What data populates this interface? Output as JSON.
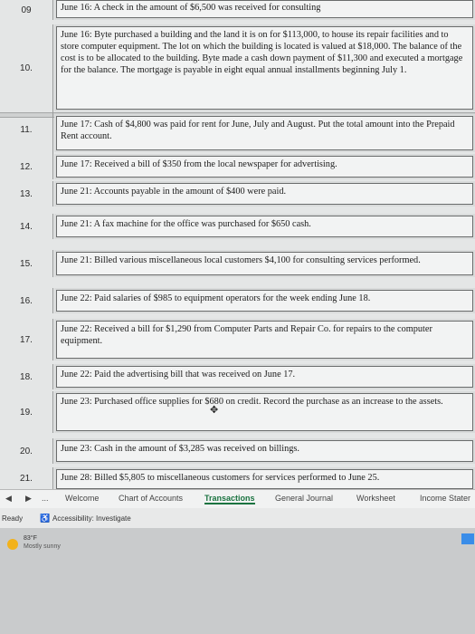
{
  "header": {
    "row_num": "09",
    "text": "June 16: A check in the amount of $6,500 was received for consulting"
  },
  "rows": [
    {
      "num": "10.",
      "text": "June 16: Byte purchased a building and the land it is on for $113,000, to house its repair facilities and to store computer equipment. The lot on which the building is located is valued at $18,000. The balance of the cost is to be allocated to the building. Byte made a cash down payment of $11,300 and executed a mortgage for the balance. The mortgage is payable in eight equal annual installments beginning July 1."
    },
    {
      "num": "11.",
      "text": "June 17: Cash of $4,800 was paid for rent for June, July and August. Put the total amount into the Prepaid Rent account."
    },
    {
      "num": "12.",
      "text": "June 17: Received a bill of $350 from the local newspaper for advertising."
    },
    {
      "num": "13.",
      "text": "June 21: Accounts payable in the amount of $400 were paid."
    },
    {
      "num": "14.",
      "text": "June 21: A fax machine for the office was purchased for $650 cash."
    },
    {
      "num": "15.",
      "text": "June 21: Billed various miscellaneous local customers $4,100 for consulting services performed."
    },
    {
      "num": "16.",
      "text": "June 22: Paid salaries of $985 to equipment operators for the week ending June 18."
    },
    {
      "num": "17.",
      "text": "June 22: Received a bill for $1,290 from Computer Parts and Repair Co. for repairs to the computer equipment."
    },
    {
      "num": "18.",
      "text": "June 22: Paid the advertising bill that was received on June 17."
    },
    {
      "num": "19.",
      "text": "June 23: Purchased office supplies for $680 on credit. Record the purchase as an increase to the assets."
    },
    {
      "num": "20.",
      "text": "June 23: Cash in the amount of $3,285 was received on billings."
    },
    {
      "num": "21.",
      "text": "June 28: Billed $5,805 to miscellaneous customers for services performed to June 25."
    }
  ],
  "sheet_tabs": {
    "ellipsis": "...",
    "tabs": [
      "Welcome",
      "Chart of Accounts",
      "Transactions",
      "General Journal",
      "Worksheet",
      "Income Stater"
    ],
    "active": "Transactions"
  },
  "status": {
    "ready": "Ready",
    "accessibility": "Accessibility: Investigate"
  },
  "weather": {
    "temp": "83°F",
    "condition": "Mostly sunny"
  }
}
